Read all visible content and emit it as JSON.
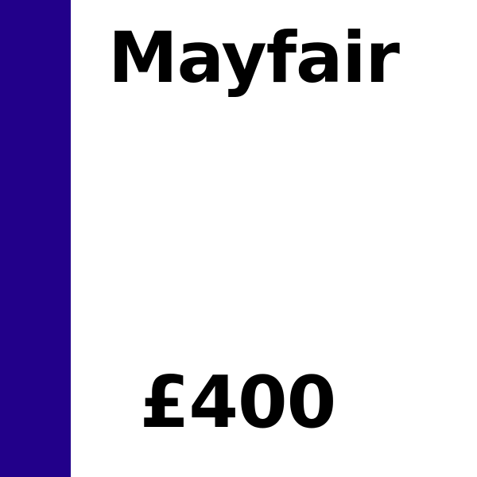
{
  "card": {
    "name": "Mayfair",
    "price": "£400",
    "band_color": "#22008a"
  }
}
